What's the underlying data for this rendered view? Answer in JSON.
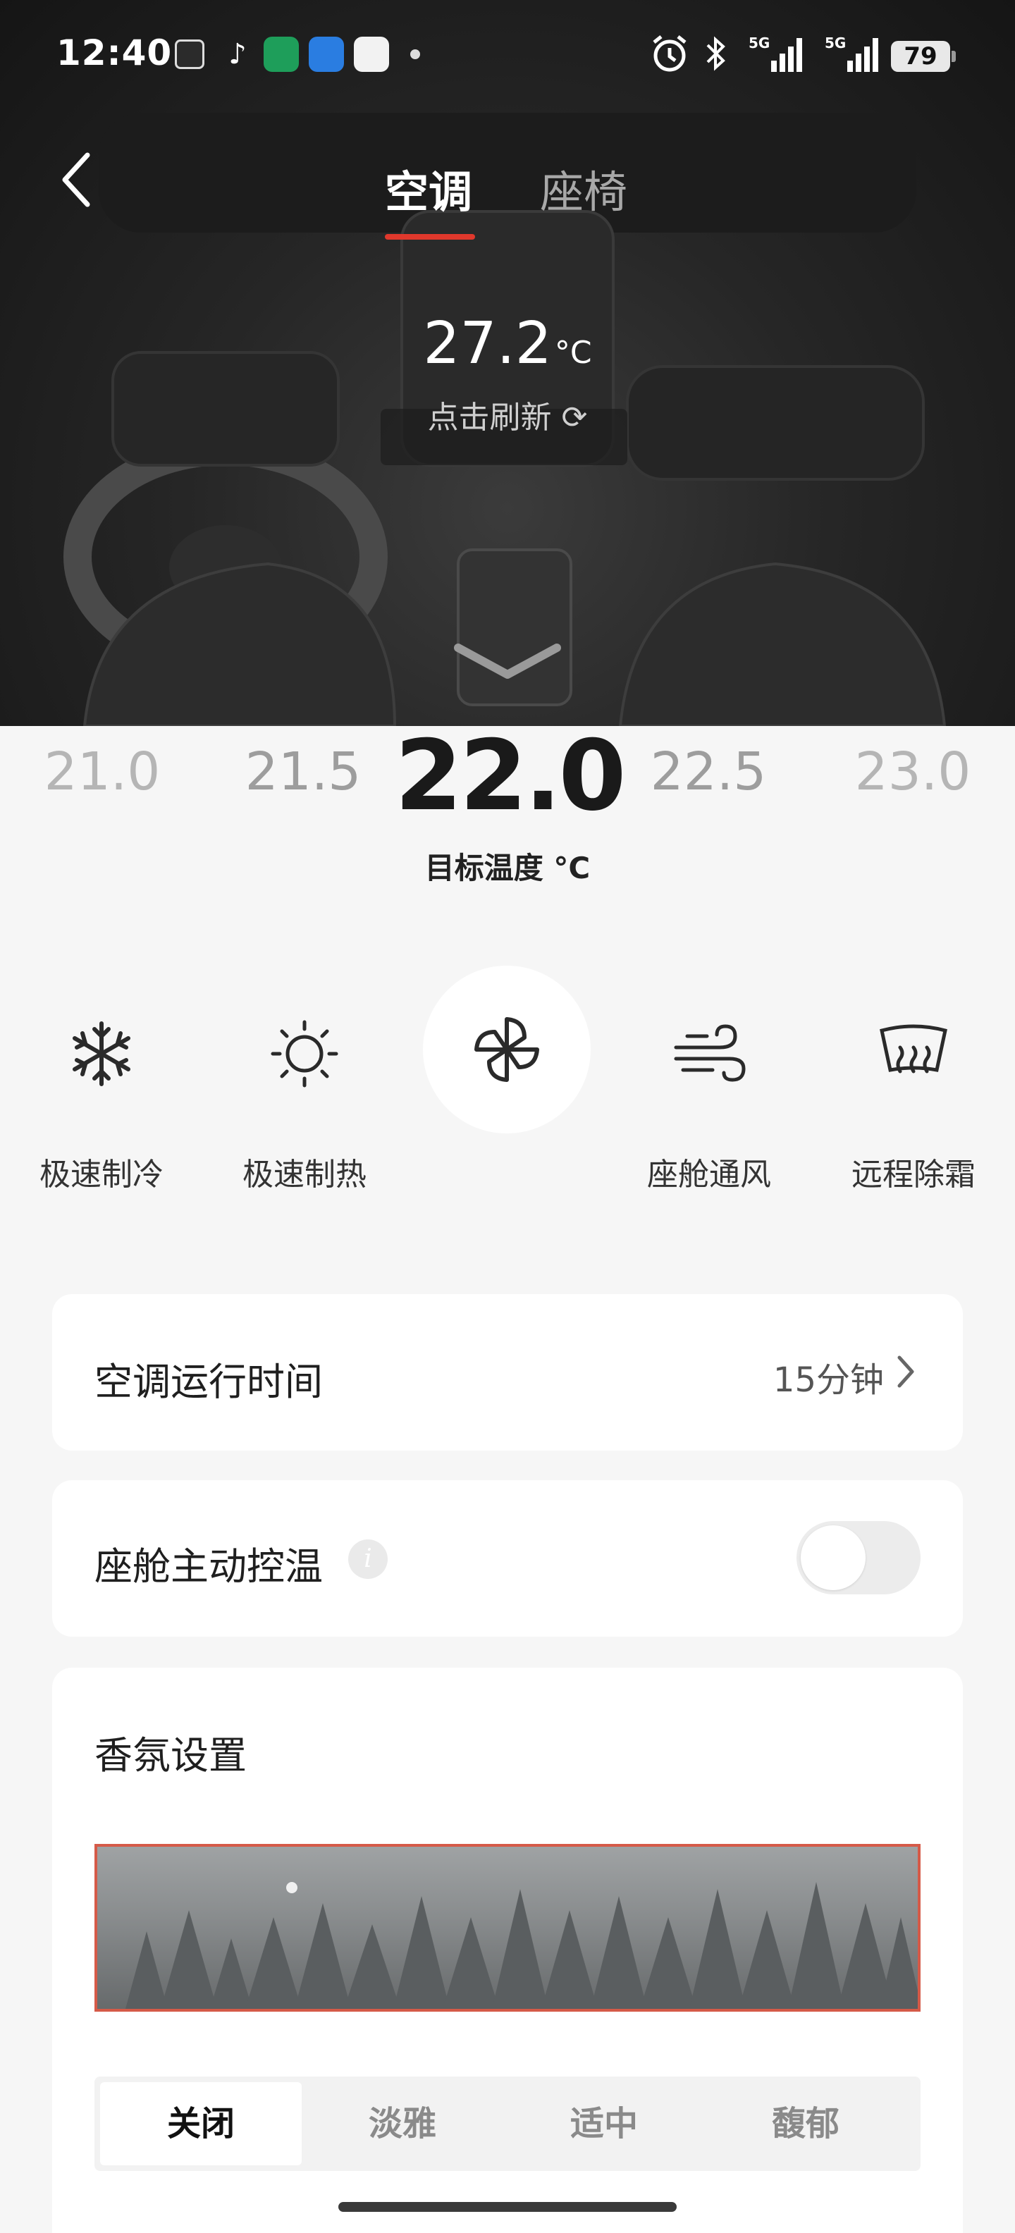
{
  "status_bar": {
    "time": "12:40",
    "battery": "79",
    "signal_1": "5G",
    "signal_2": "5G"
  },
  "header": {
    "tabs": [
      "空调",
      "座椅"
    ],
    "active_tab": 0
  },
  "cabin": {
    "current_temp": "27.2",
    "unit": "°C",
    "refresh_label": "点击刷新 ⟳"
  },
  "picker": {
    "values": [
      "21.0",
      "21.5",
      "22.0",
      "22.5",
      "23.0"
    ],
    "selected": "22.0",
    "label": "目标温度 °C"
  },
  "modes": [
    {
      "label": "极速制冷",
      "icon": "snowflake-icon"
    },
    {
      "label": "极速制热",
      "icon": "sun-icon"
    },
    {
      "label": "",
      "icon": "fan-icon",
      "active": true
    },
    {
      "label": "座舱通风",
      "icon": "wind-icon"
    },
    {
      "label": "远程除霜",
      "icon": "defrost-icon"
    }
  ],
  "runtime": {
    "label": "空调运行时间",
    "value": "15分钟"
  },
  "cabin_temp_control": {
    "label": "座舱主动控温",
    "info": "i",
    "enabled": false
  },
  "scent": {
    "title": "香氛设置",
    "levels": [
      "关闭",
      "淡雅",
      "适中",
      "馥郁"
    ],
    "selected": "关闭"
  },
  "colors": {
    "accent": "#e0382c",
    "hero_bg": "#1e1e1e",
    "page_bg": "#f6f6f6",
    "scent_border": "#d55a48"
  }
}
